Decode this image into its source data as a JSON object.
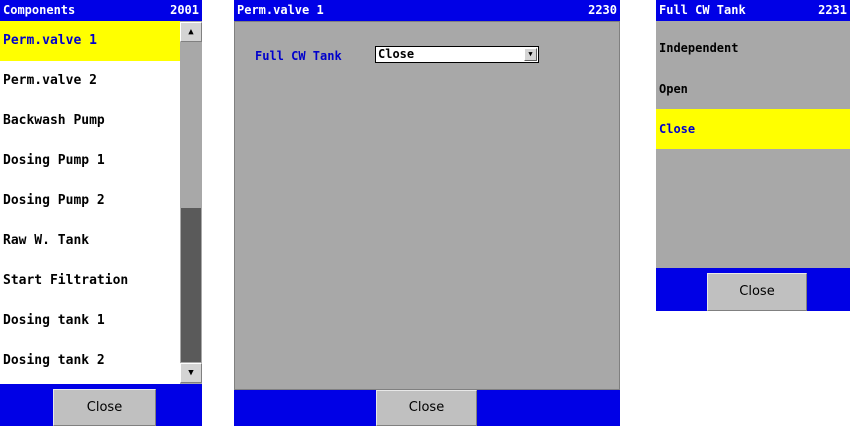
{
  "components_panel": {
    "title": "Components",
    "code": "2001",
    "items": [
      {
        "label": "Perm.valve 1"
      },
      {
        "label": "Perm.valve 2"
      },
      {
        "label": "Backwash Pump"
      },
      {
        "label": "Dosing Pump 1"
      },
      {
        "label": "Dosing Pump 2"
      },
      {
        "label": "Raw W. Tank"
      },
      {
        "label": "Start Filtration"
      },
      {
        "label": "Dosing tank 1"
      },
      {
        "label": "Dosing tank 2"
      }
    ],
    "selected_index": 0,
    "close_label": "Close"
  },
  "valve_panel": {
    "title": "Perm.valve 1",
    "code": "2230",
    "field_label": "Full CW Tank",
    "field_value": "Close",
    "close_label": "Close"
  },
  "options_panel": {
    "title": "Full CW Tank",
    "code": "2231",
    "options": [
      {
        "label": "Independent"
      },
      {
        "label": "Open"
      },
      {
        "label": "Close"
      }
    ],
    "selected_index": 2,
    "close_label": "Close"
  },
  "colors": {
    "titlebar": "#0000e6",
    "selection": "#ffff00",
    "panel_bg": "#a8a8a8",
    "label_text": "#0000cc"
  },
  "icons": {
    "scroll_up": "arrow-up-icon",
    "scroll_down": "arrow-down-icon",
    "dropdown": "chevron-down-icon"
  }
}
